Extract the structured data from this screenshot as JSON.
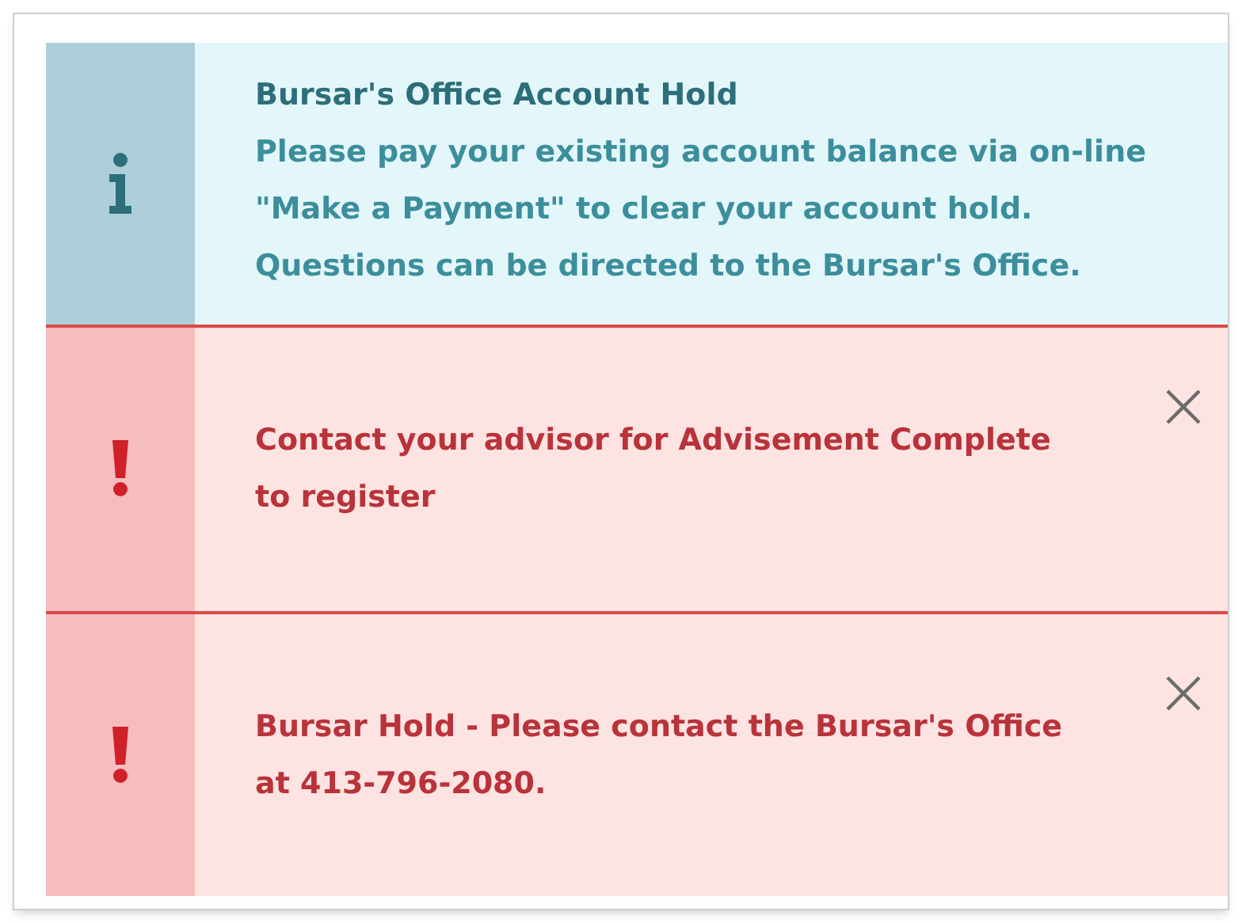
{
  "notices": [
    {
      "kind": "info",
      "title": "Bursar's Office Account Hold",
      "message": "Please pay your existing account balance via on-line \"Make a Payment\" to clear your account hold. Questions can be directed to the Bursar's Office.",
      "dismissible": false
    },
    {
      "kind": "error",
      "message": "Contact your advisor for Advisement Complete to register",
      "dismissible": true
    },
    {
      "kind": "error",
      "message": "Bursar Hold - Please contact the Bursar's Office at 413-796-2080.",
      "dismissible": true
    }
  ]
}
